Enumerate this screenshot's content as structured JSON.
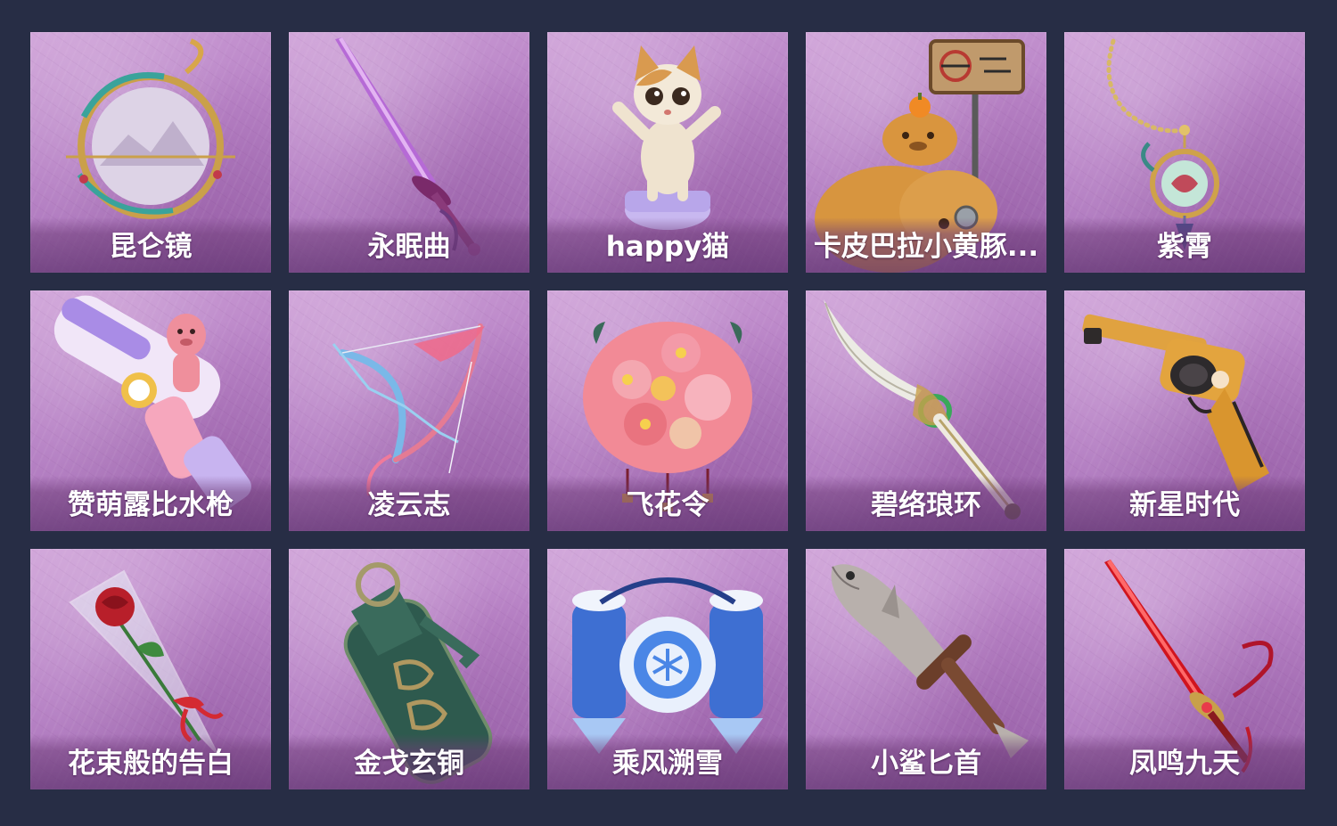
{
  "items": [
    {
      "name": "昆仑镜",
      "icon": "mirror-icon"
    },
    {
      "name": "永眠曲",
      "icon": "sword-icon"
    },
    {
      "name": "happy猫",
      "icon": "cat-figure-icon"
    },
    {
      "name": "卡皮巴拉小黄豚...",
      "icon": "capybara-icon"
    },
    {
      "name": "紫霄",
      "icon": "pendant-icon"
    },
    {
      "name": "赞萌露比水枪",
      "icon": "water-gun-icon"
    },
    {
      "name": "凌云志",
      "icon": "bow-icon"
    },
    {
      "name": "飞花令",
      "icon": "flower-bouquet-icon"
    },
    {
      "name": "碧络琅环",
      "icon": "curved-blade-icon"
    },
    {
      "name": "新星时代",
      "icon": "revolver-icon"
    },
    {
      "name": "花束般的告白",
      "icon": "rose-icon"
    },
    {
      "name": "金戈玄铜",
      "icon": "grenade-icon"
    },
    {
      "name": "乘风溯雪",
      "icon": "snow-backpack-icon"
    },
    {
      "name": "小鲨匕首",
      "icon": "shark-dagger-icon"
    },
    {
      "name": "凤鸣九天",
      "icon": "crimson-sword-icon"
    }
  ]
}
